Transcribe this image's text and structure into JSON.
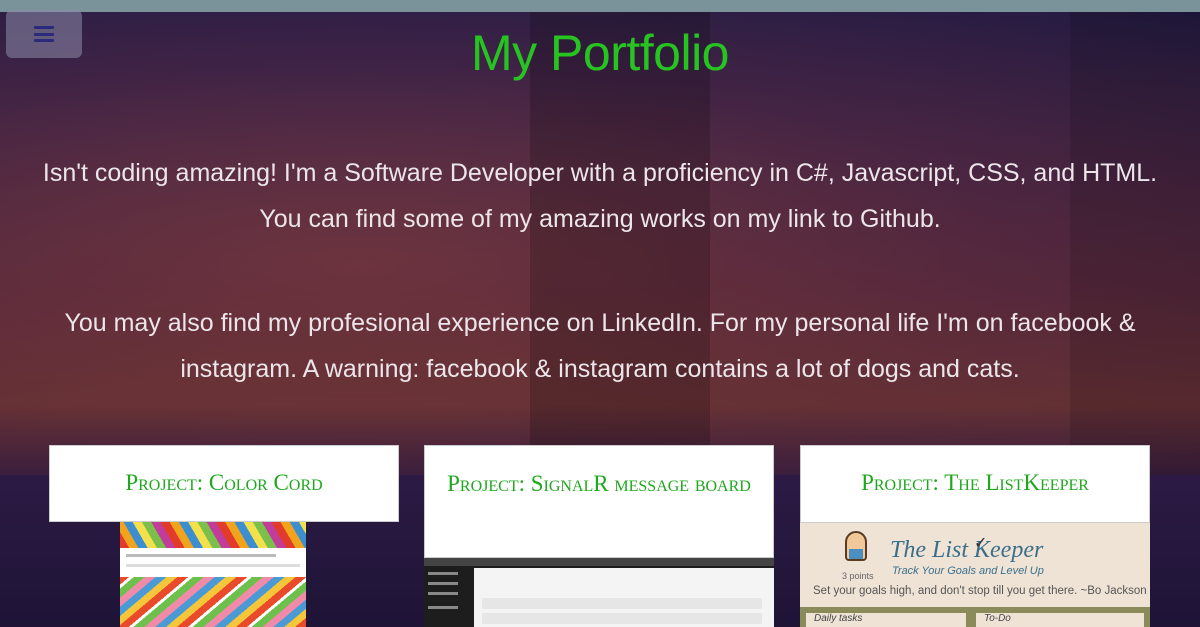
{
  "header": {
    "menu_icon": "hamburger-menu-icon",
    "title": "My Portfolio"
  },
  "intro": {
    "paragraph_1_line_1": "Isn't coding amazing! I'm a Software Developer with a proficiency in C#, Javascript, CSS, and HTML.",
    "paragraph_1_line_2": "You can find some of my amazing works on my link to Github.",
    "paragraph_2_line_1": "You may also find my profesional experience on LinkedIn. For my personal life I'm on facebook &",
    "paragraph_2_line_2": "instagram. A warning: facebook & instagram contains a lot of dogs and cats."
  },
  "projects": [
    {
      "title": "Project: Color Cord"
    },
    {
      "title": "Project: SignalR message board"
    },
    {
      "title": "Project: The ListKeeper",
      "thumb_title": "The List Keeper",
      "thumb_subtitle": "Track Your Goals and Level Up",
      "thumb_points": "3 points",
      "thumb_quote": "Set your goals high, and don't stop till you get there. ~Bo Jackson",
      "thumb_col_1": "Daily tasks",
      "thumb_col_2": "To-Do"
    }
  ],
  "colors": {
    "accent_green": "#27c421",
    "card_title_green": "#1fa81d",
    "menu_icon": "#2c2a7a"
  }
}
